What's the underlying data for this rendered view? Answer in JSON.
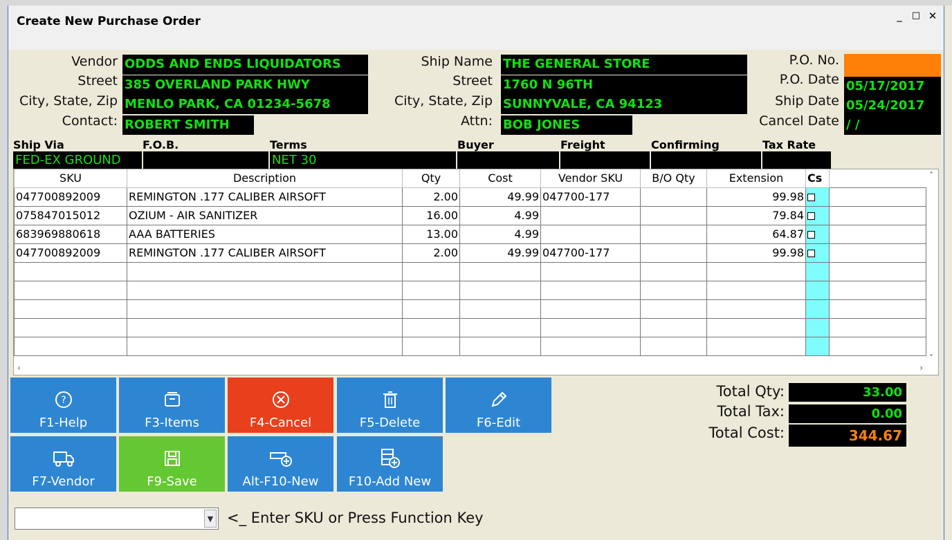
{
  "window": {
    "title": "Create New Purchase Order",
    "minimize": "_",
    "maximize": "□",
    "close": "✕"
  },
  "vendor": {
    "labels": {
      "vendor": "Vendor",
      "street": "Street",
      "city": "City, State, Zip",
      "contact": "Contact:"
    },
    "name": "ODDS AND ENDS LIQUIDATORS",
    "street": "385 OVERLAND PARK HWY",
    "city": "MENLO PARK, CA  01234-5678",
    "contact": "ROBERT SMITH"
  },
  "ship": {
    "labels": {
      "name": "Ship Name",
      "street": "Street",
      "city": "City, State, Zip",
      "attn": "Attn:"
    },
    "name": "THE GENERAL STORE",
    "street": "1760 N 96TH",
    "city": "SUNNYVALE, CA  94123",
    "attn": "BOB JONES"
  },
  "po": {
    "labels": {
      "no": "P.O. No.",
      "date": "P.O. Date",
      "ship_date": "Ship Date",
      "cancel_date": "Cancel Date"
    },
    "no": "",
    "date": "05/17/2017",
    "ship_date": "05/24/2017",
    "cancel_date": " / /"
  },
  "header_fields": {
    "ship_via": {
      "label": "Ship Via",
      "value": "FED-EX GROUND"
    },
    "fob": {
      "label": "F.O.B.",
      "value": ""
    },
    "terms": {
      "label": "Terms",
      "value": "NET 30"
    },
    "buyer": {
      "label": "Buyer",
      "value": ""
    },
    "freight": {
      "label": "Freight",
      "value": ""
    },
    "confirming": {
      "label": "Confirming",
      "value": ""
    },
    "tax_rate": {
      "label": "Tax Rate",
      "value": ""
    }
  },
  "grid": {
    "columns": [
      "SKU",
      "Description",
      "Qty",
      "Cost",
      "Vendor SKU",
      "B/O Qty",
      "Extension",
      "Cs"
    ],
    "rows": [
      {
        "sku": "047700892009",
        "description": "REMINGTON .177 CALIBER AIRSOFT",
        "qty": "2.00",
        "cost": "49.99",
        "vendor_sku": "047700-177",
        "bo_qty": "",
        "extension": "99.98"
      },
      {
        "sku": "075847015012",
        "description": "OZIUM - AIR SANITIZER",
        "qty": "16.00",
        "cost": "4.99",
        "vendor_sku": "",
        "bo_qty": "",
        "extension": "79.84"
      },
      {
        "sku": "683969880618",
        "description": "AAA BATTERIES",
        "qty": "13.00",
        "cost": "4.99",
        "vendor_sku": "",
        "bo_qty": "",
        "extension": "64.87"
      },
      {
        "sku": "047700892009",
        "description": "REMINGTON .177 CALIBER AIRSOFT",
        "qty": "2.00",
        "cost": "49.99",
        "vendor_sku": "047700-177",
        "bo_qty": "",
        "extension": "99.98"
      }
    ]
  },
  "buttons": {
    "help": "F1-Help",
    "items": "F3-Items",
    "cancel": "F4-Cancel",
    "delete": "F5-Delete",
    "edit": "F6-Edit",
    "vendor": "F7-Vendor",
    "save": "F9-Save",
    "alt_new": "Alt-F10-New",
    "add_new": "F10-Add New"
  },
  "totals": {
    "qty_label": "Total Qty:",
    "qty": "33.00",
    "tax_label": "Total Tax:",
    "tax": "0.00",
    "cost_label": "Total Cost:",
    "cost": "344.67"
  },
  "entry": {
    "value": "",
    "prompt": "<_ Enter SKU or Press Function Key"
  },
  "colors": {
    "field_bg": "#000000",
    "field_text": "#11e011",
    "po_no_bg": "#ff8008",
    "cost_total": "#ff8008",
    "btn_blue": "#2e86d2",
    "btn_red": "#e8401c",
    "btn_green": "#64c832",
    "cs_col": "#7ffcfc"
  }
}
